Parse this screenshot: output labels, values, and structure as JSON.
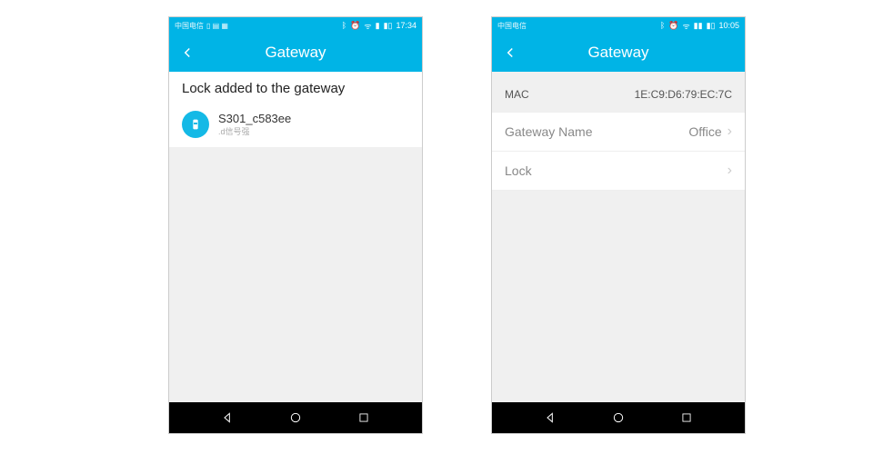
{
  "left": {
    "statusbar": {
      "carrier": "中国电信",
      "time": "17:34"
    },
    "header": {
      "title": "Gateway"
    },
    "section_title": "Lock added to the gateway",
    "lock": {
      "name": "S301_c583ee",
      "sub": ".d信号强"
    }
  },
  "right": {
    "statusbar": {
      "carrier": "中国电信",
      "time": "10:05"
    },
    "header": {
      "title": "Gateway"
    },
    "mac": {
      "label": "MAC",
      "value": "1E:C9:D6:79:EC:7C"
    },
    "rows": {
      "name_label": "Gateway Name",
      "name_value": "Office",
      "lock_label": "Lock"
    }
  }
}
